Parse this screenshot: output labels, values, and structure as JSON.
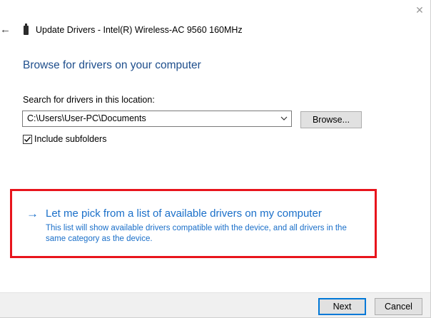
{
  "window": {
    "title": "Update Drivers - Intel(R) Wireless-AC 9560 160MHz",
    "back_icon": "back-arrow-icon",
    "close_icon": "close-icon",
    "device_icon": "usb-device-icon"
  },
  "main": {
    "heading": "Browse for drivers on your computer",
    "search_label": "Search for drivers in this location:",
    "path_value": "C:\\Users\\User-PC\\Documents",
    "browse_label": "Browse...",
    "include_subfolders_label": "Include subfolders",
    "include_subfolders_checked": true
  },
  "pick_option": {
    "arrow": "→",
    "title": "Let me pick from a list of available drivers on my computer",
    "description": "This list will show available drivers compatible with the device, and all drivers in the same category as the device.",
    "highlight_color": "#e8141c",
    "link_color": "#1a6fc9"
  },
  "footer": {
    "next_label": "Next",
    "cancel_label": "Cancel"
  },
  "colors": {
    "heading": "#1e4e8c",
    "footer_bg": "#f0f0f0",
    "default_button_border": "#0078d7"
  }
}
